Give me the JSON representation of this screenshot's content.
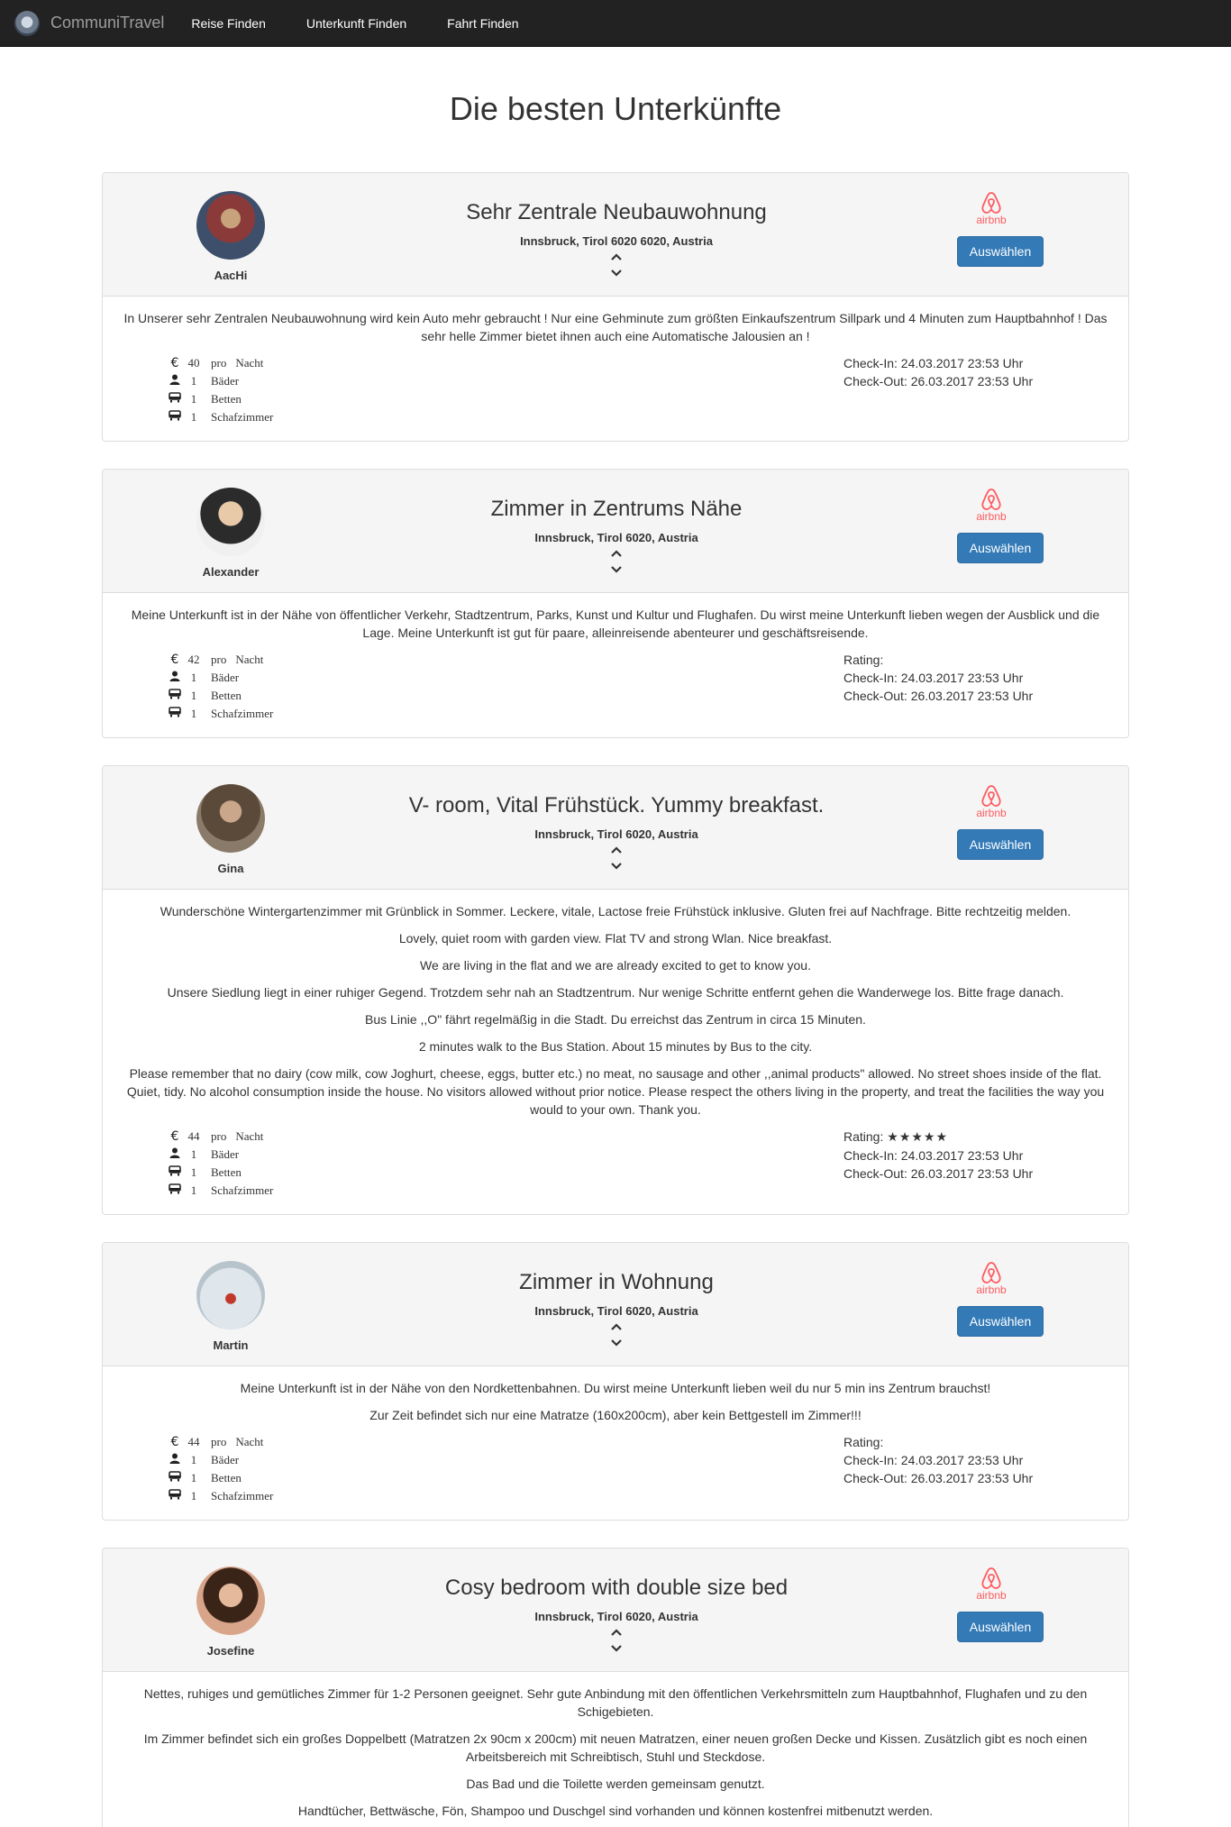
{
  "nav": {
    "brand": "CommuniTravel",
    "links": [
      "Reise Finden",
      "Unterkunft Finden",
      "Fahrt Finden"
    ]
  },
  "page_title": "Die besten Unterkünfte",
  "common": {
    "select_label": "Auswählen",
    "airbnb_label": "airbnb",
    "pro": "pro",
    "night": "Nacht",
    "baths": "Bäder",
    "beds": "Betten",
    "bedrooms": "Schafzimmer",
    "euro": "€"
  },
  "listings": [
    {
      "host": "AacHi",
      "title": "Sehr Zentrale Neubauwohnung",
      "location": "Innsbruck, Tirol 6020 6020, Austria",
      "description": [
        "In Unserer sehr Zentralen Neubauwohnung wird kein Auto mehr gebraucht ! Nur eine Gehminute zum größten Einkaufszentrum Sillpark und 4 Minuten zum Hauptbahnhof ! Das sehr helle Zimmer bietet ihnen auch eine Automatische Jalousien an !"
      ],
      "price": "40",
      "baths": "1",
      "beds": "1",
      "bedrooms": "1",
      "rating": "",
      "check_in": "Check-In: 24.03.2017 23:53 Uhr",
      "check_out": "Check-Out: 26.03.2017 23:53 Uhr"
    },
    {
      "host": "Alexander",
      "title": "Zimmer in Zentrums Nähe",
      "location": "Innsbruck, Tirol 6020, Austria",
      "description": [
        "Meine Unterkunft ist in der Nähe von öffentlicher Verkehr, Stadtzentrum, Parks, Kunst und Kultur und Flughafen. Du wirst meine Unterkunft lieben wegen der Ausblick und die Lage. Meine Unterkunft ist gut für paare, alleinreisende abenteurer und geschäftsreisende."
      ],
      "price": "42",
      "baths": "1",
      "beds": "1",
      "bedrooms": "1",
      "rating": "Rating:",
      "check_in": "Check-In: 24.03.2017 23:53 Uhr",
      "check_out": "Check-Out: 26.03.2017 23:53 Uhr"
    },
    {
      "host": "Gina",
      "title": "V- room, Vital Frühstück. Yummy breakfast.",
      "location": "Innsbruck, Tirol 6020, Austria",
      "description": [
        "Wunderschöne Wintergartenzimmer mit Grünblick in Sommer. Leckere, vitale, Lactose freie Frühstück inklusive. Gluten frei auf Nachfrage. Bitte rechtzeitig melden.",
        "Lovely, quiet room with garden view. Flat TV and strong Wlan. Nice breakfast.",
        "We are living in the flat and we are already excited to get to know you.",
        "Unsere Siedlung liegt in einer ruhiger Gegend. Trotzdem sehr nah an Stadtzentrum. Nur wenige Schritte entfernt gehen die Wanderwege los. Bitte frage danach.",
        "Bus Linie ,,O\" fährt regelmäßig in die Stadt. Du erreichst das Zentrum in circa 15 Minuten.",
        "2 minutes walk to the Bus Station. About 15 minutes by Bus to the city.",
        "Please remember that no dairy (cow milk, cow Joghurt, cheese, eggs, butter etc.) no meat, no sausage and other ,,animal products\" allowed. No street shoes inside of the flat. Quiet, tidy. No alcohol consumption inside the house. No visitors allowed without prior notice. Please respect the others living in the property, and treat the facilities the way you would to your own. Thank you."
      ],
      "price": "44",
      "baths": "1",
      "beds": "1",
      "bedrooms": "1",
      "rating": "Rating:",
      "rating_stars": "★★★★★",
      "check_in": "Check-In: 24.03.2017 23:53 Uhr",
      "check_out": "Check-Out: 26.03.2017 23:53 Uhr"
    },
    {
      "host": "Martin",
      "title": "Zimmer in Wohnung",
      "location": "Innsbruck, Tirol 6020, Austria",
      "description": [
        "Meine Unterkunft ist in der Nähe von den Nordkettenbahnen. Du wirst meine Unterkunft lieben weil du nur 5 min ins Zentrum brauchst!",
        "Zur Zeit befindet sich nur eine Matratze (160x200cm), aber kein Bettgestell im Zimmer!!!"
      ],
      "price": "44",
      "baths": "1",
      "beds": "1",
      "bedrooms": "1",
      "rating": "Rating:",
      "check_in": "Check-In: 24.03.2017 23:53 Uhr",
      "check_out": "Check-Out: 26.03.2017 23:53 Uhr"
    },
    {
      "host": "Josefine",
      "title": "Cosy bedroom with double size bed",
      "location": "Innsbruck, Tirol 6020, Austria",
      "description": [
        "Nettes, ruhiges und gemütliches Zimmer für 1-2 Personen geeignet. Sehr gute Anbindung mit den öffentlichen Verkehrsmitteln zum Hauptbahnhof, Flughafen und zu den Schigebieten.",
        "Im Zimmer befindet sich ein großes Doppelbett (Matratzen 2x 90cm x 200cm) mit neuen Matratzen, einer neuen großen Decke und Kissen. Zusätzlich gibt es noch einen Arbeitsbereich mit Schreibtisch, Stuhl und Steckdose.",
        "Das Bad und die Toilette werden gemeinsam genutzt.",
        "Handtücher, Bettwäsche, Fön, Shampoo und Duschgel sind vorhanden und können kostenfrei mitbenutzt werden."
      ]
    }
  ]
}
